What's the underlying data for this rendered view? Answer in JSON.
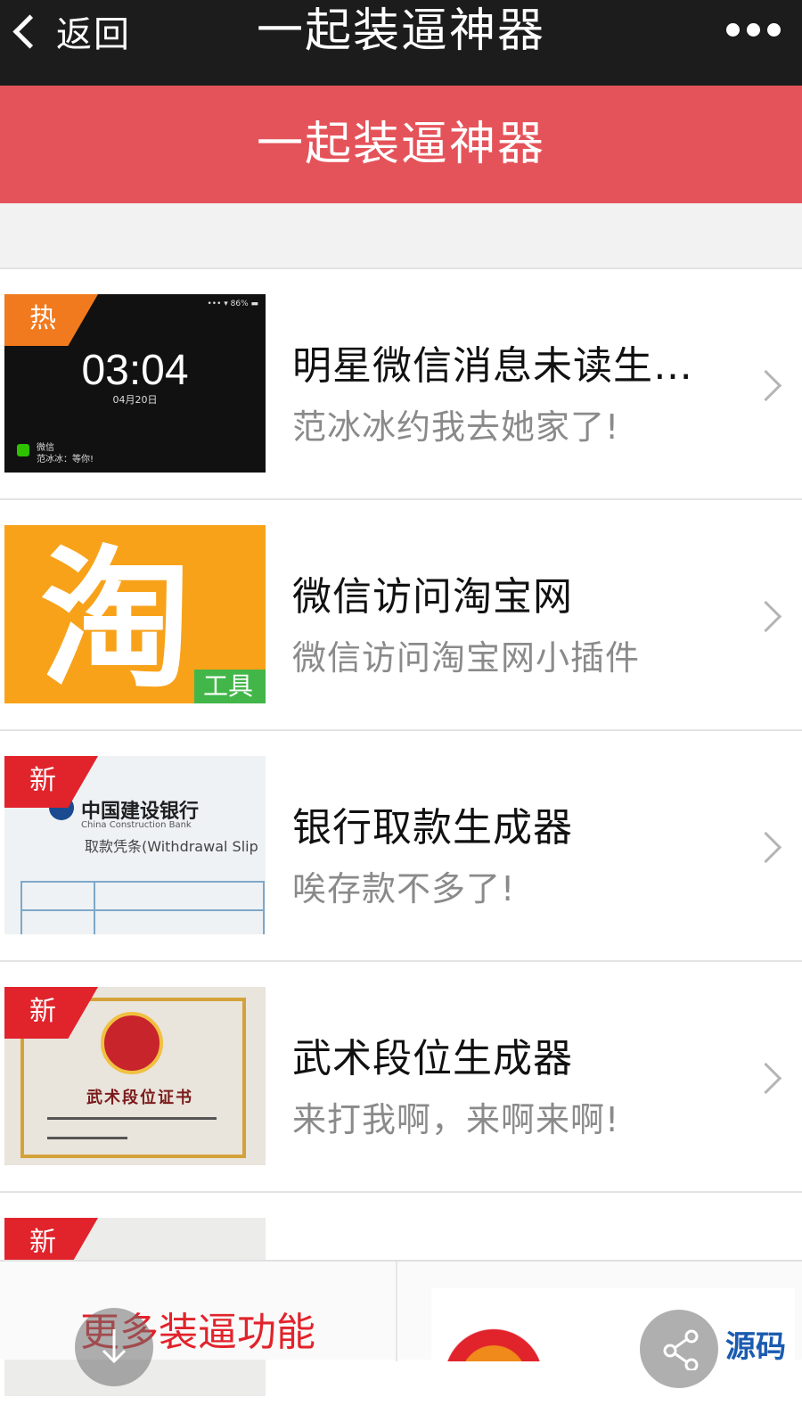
{
  "navbar": {
    "back_label": "返回",
    "title": "一起装逼神器"
  },
  "banner": {
    "title": "一起装逼神器"
  },
  "items": [
    {
      "title": "明星微信消息未读生…",
      "subtitle": "范冰冰约我去她家了!",
      "badge": "热",
      "thumb": {
        "time": "03:04",
        "date": "04月20日",
        "status": "••• ▾ 86% ▬",
        "notice_app": "微信",
        "notice_text": "范冰冰：等你!"
      }
    },
    {
      "title": "微信访问淘宝网",
      "subtitle": "微信访问淘宝网小插件",
      "badge": "工具",
      "thumb": {
        "glyph": "淘"
      }
    },
    {
      "title": "银行取款生成器",
      "subtitle": "唉存款不多了!",
      "badge": "新",
      "thumb": {
        "bank": "中国建设银行",
        "bank_en": "China Construction Bank",
        "slip": "取款凭条(Withdrawal Slip"
      }
    },
    {
      "title": "武术段位生成器",
      "subtitle": "来打我啊，来啊来啊!",
      "badge": "新",
      "thumb": {
        "cert_title": "武术段位证书"
      }
    },
    {
      "title": "",
      "subtitle": "",
      "badge": "新"
    }
  ],
  "footer": {
    "more_label": "更多装逼功能",
    "ad_text": "源码"
  },
  "colors": {
    "navbar": "#1c1c1c",
    "banner": "#e5535a",
    "hot_tag": "#f07a1d",
    "new_tag": "#e1232b",
    "tool_tag": "#42b649",
    "more_text": "#e1232b"
  }
}
